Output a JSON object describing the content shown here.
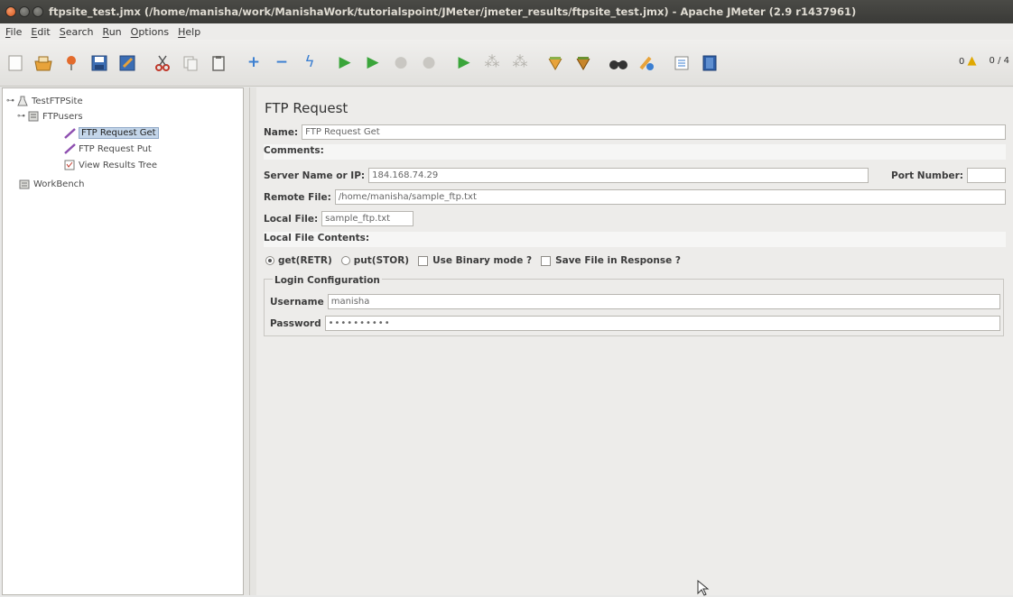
{
  "window": {
    "title": "ftpsite_test.jmx (/home/manisha/work/ManishaWork/tutorialspoint/JMeter/jmeter_results/ftpsite_test.jmx) - Apache JMeter (2.9 r1437961)"
  },
  "menu": [
    "File",
    "Edit",
    "Search",
    "Run",
    "Options",
    "Help"
  ],
  "toolbar": {
    "icons": [
      "new-icon",
      "templates-icon",
      "open-icon",
      "save-icon",
      "save-as-icon",
      "cut-icon",
      "copy-icon",
      "paste-icon",
      "expand-icon",
      "collapse-icon",
      "toggle-icon",
      "start-icon",
      "start-no-timers-icon",
      "stop-icon",
      "shutdown-icon",
      "remote-start-icon",
      "remote-stop-icon",
      "remote-exit-icon",
      "clear-icon",
      "clear-all-icon",
      "search-icon",
      "reset-search-icon",
      "function-helper-icon",
      "help-icon"
    ],
    "warnings_count": "0",
    "threads": "0 / 4"
  },
  "tree": {
    "root": "TestFTPSite",
    "thread_group": "FTPusers",
    "items": [
      "FTP Request Get",
      "FTP Request Put",
      "View Results Tree"
    ],
    "workbench": "WorkBench"
  },
  "form": {
    "title": "FTP Request",
    "name_label": "Name:",
    "name_value": "FTP Request Get",
    "comments_label": "Comments:",
    "server_label": "Server Name or IP:",
    "server_value": "184.168.74.29",
    "port_label": "Port Number:",
    "port_value": "",
    "remote_label": "Remote File:",
    "remote_value": "/home/manisha/sample_ftp.txt",
    "local_label": "Local File:",
    "local_value": "sample_ftp.txt",
    "contents_label": "Local File Contents:",
    "radio_get": "get(RETR)",
    "radio_put": "put(STOR)",
    "binary_label": "Use Binary mode ?",
    "save_label": "Save File in Response ?",
    "login_title": "Login Configuration",
    "username_label": "Username",
    "username_value": "manisha",
    "password_label": "Password",
    "password_value": "••••••••••"
  }
}
